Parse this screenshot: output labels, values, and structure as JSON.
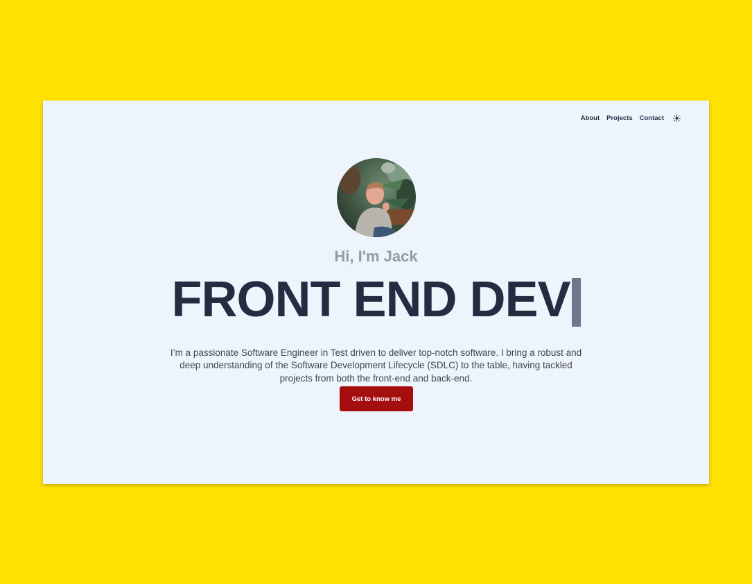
{
  "nav": {
    "items": [
      "About",
      "Projects",
      "Contact"
    ],
    "theme_icon": "sun-icon"
  },
  "hero": {
    "avatar_icon": "profile-photo",
    "greeting": "Hi, I'm Jack",
    "headline": "FRONT END DEV",
    "bio": "I’m a passionate Software Engineer in Test driven to deliver top-notch software. I bring a robust and deep understanding of the Software Development Lifecycle (SDLC) to the table, having tackled projects from both the front-end and back-end.",
    "cta_label": "Get to know me"
  },
  "colors": {
    "background": "#FFE200",
    "page": "#EEF4FC",
    "text_dark": "#262B42",
    "text_muted": "#9499A6",
    "cta": "#A40E0E"
  }
}
